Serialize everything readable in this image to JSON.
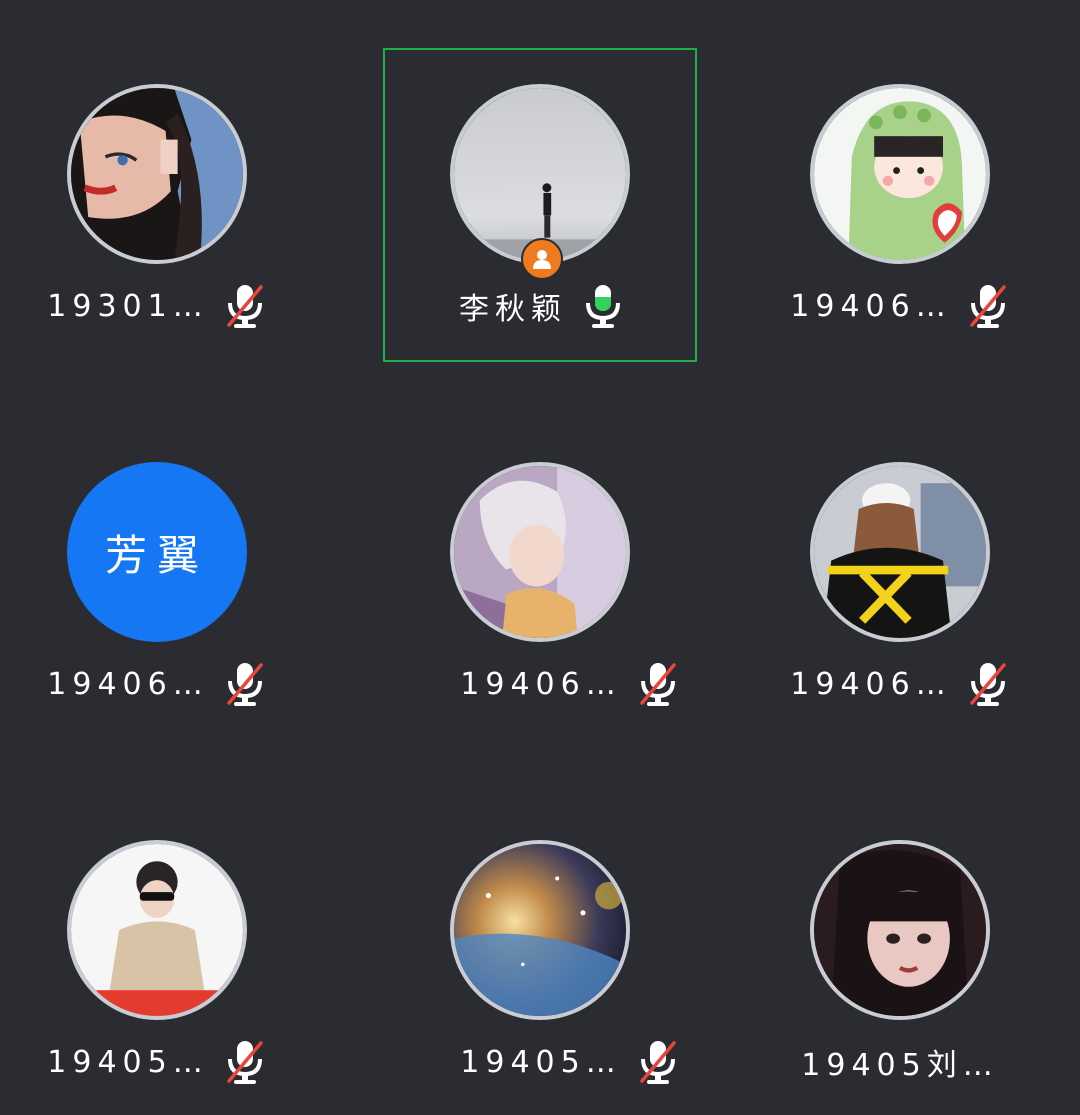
{
  "participants": [
    {
      "name": "19301…",
      "mic": "muted",
      "avatar": "photo-girl-illustration",
      "active": false
    },
    {
      "name": "李秋颖",
      "mic": "speaking",
      "avatar": "photo-person-sea",
      "active": true,
      "host": true
    },
    {
      "name": "19406…",
      "mic": "muted",
      "avatar": "cartoon-dinosaur",
      "active": false
    },
    {
      "name": "19406…",
      "mic": "muted",
      "avatar_text": "芳翼",
      "avatar_color": "#1677f5",
      "active": false
    },
    {
      "name": "19406…",
      "mic": "muted",
      "avatar": "anime-girl",
      "active": false
    },
    {
      "name": "19406…",
      "mic": "muted",
      "avatar": "photo-girl-cap",
      "active": false
    },
    {
      "name": "19405…",
      "mic": "muted",
      "avatar": "photo-woman-sunglasses",
      "active": false
    },
    {
      "name": "19405…",
      "mic": "muted",
      "avatar": "galaxy",
      "active": false
    },
    {
      "name": "19405刘…",
      "mic": "none",
      "avatar": "photo-girl-dark",
      "active": false
    }
  ],
  "colors": {
    "background": "#2a2c31",
    "active_border": "#1fb04a",
    "speaking_mic": "#34d15a",
    "muted_slash": "#e8453c",
    "host_badge": "#f07b1f"
  }
}
